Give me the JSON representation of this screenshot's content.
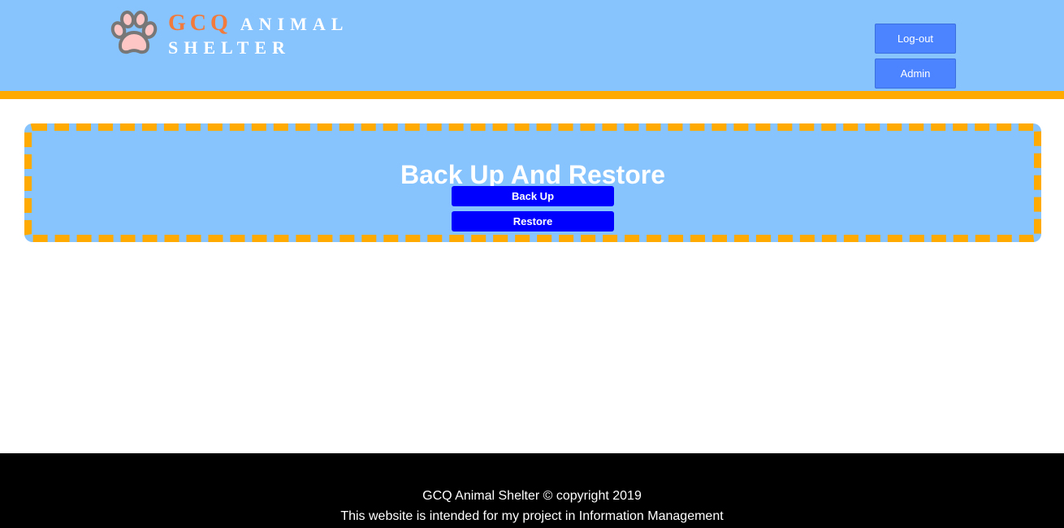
{
  "header": {
    "logo_icon": "paw-icon",
    "brand_first": "GCQ",
    "brand_second": "ANIMAL",
    "brand_third": "SHELTER",
    "logout_label": "Log-out",
    "admin_label": "Admin"
  },
  "main": {
    "title": "Back Up And Restore",
    "backup_label": "Back Up",
    "restore_label": "Restore"
  },
  "footer": {
    "line1": "GCQ Animal Shelter © copyright 2019",
    "line2": "This website is intended for my project in Information Management"
  },
  "colors": {
    "header_bg": "#87c3fd",
    "accent_orange": "#ffaa00",
    "brand_orange": "#f27a3a",
    "header_button": "#4c84ff",
    "panel_button": "#0000ff",
    "footer_bg": "#000000"
  }
}
